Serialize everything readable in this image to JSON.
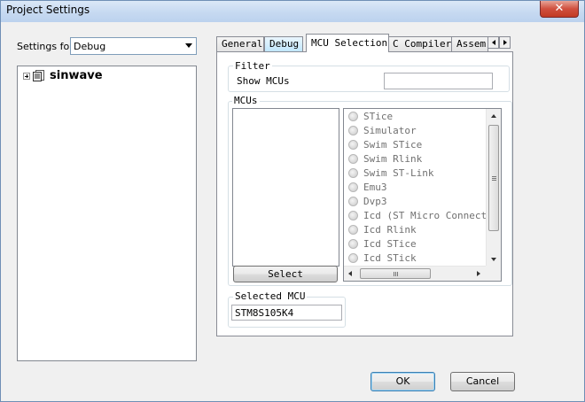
{
  "window": {
    "title": "Project Settings",
    "close_glyph": "✕"
  },
  "settings_for": {
    "label": "Settings for:",
    "value": "Debug"
  },
  "tree": {
    "root_label": "sinwave",
    "root_icon": "project-icon"
  },
  "tabs": [
    {
      "label": "General",
      "state": "normal"
    },
    {
      "label": "Debug",
      "state": "hover"
    },
    {
      "label": "MCU Selection",
      "state": "active"
    },
    {
      "label": "C Compiler",
      "state": "normal"
    },
    {
      "label": "Assem",
      "state": "normal"
    }
  ],
  "filter": {
    "group_title": "Filter",
    "label": "Show MCUs",
    "value": ""
  },
  "mcus": {
    "group_title": "MCUs",
    "select_label": "Select",
    "items": [
      "STice",
      "Simulator",
      "Swim STice",
      "Swim Rlink",
      "Swim ST-Link",
      "Emu3",
      "Dvp3",
      "Icd (ST Micro Connect d",
      "Icd Rlink",
      "Icd STice",
      "Icd STick"
    ]
  },
  "selected_mcu": {
    "group_title": "Selected MCU",
    "value": "STM8S105K4"
  },
  "footer": {
    "ok_label": "OK",
    "cancel_label": "Cancel"
  },
  "colors": {
    "titlebar": "#c6d9f1",
    "close": "#c23b24",
    "dialog_bg": "#f0f0f0",
    "disabled_text": "#707070"
  }
}
